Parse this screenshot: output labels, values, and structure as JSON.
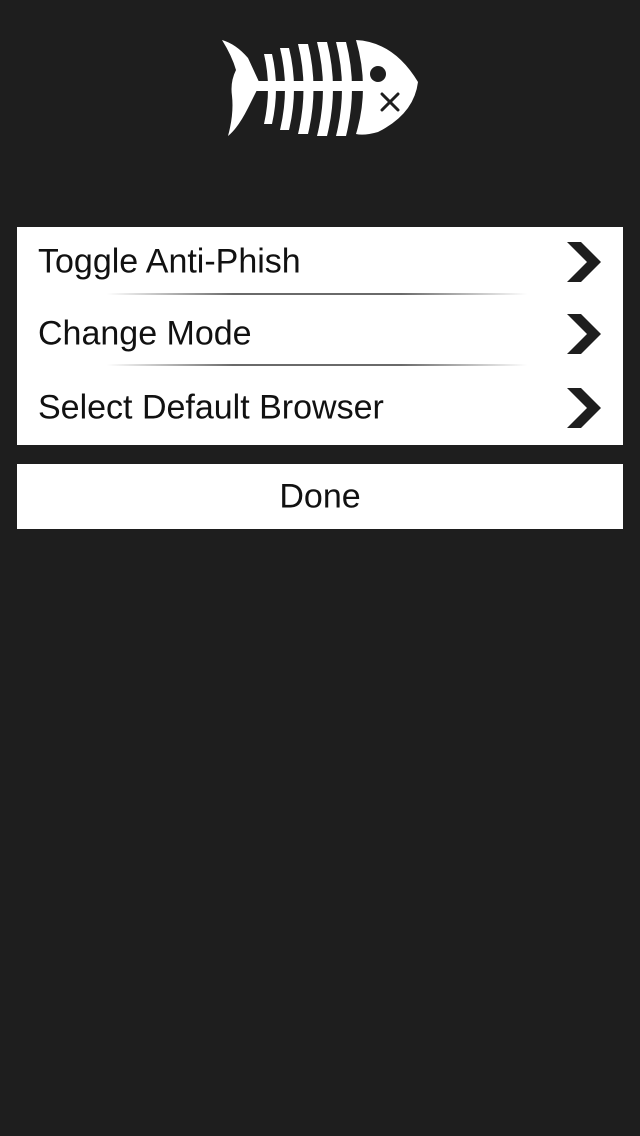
{
  "logo": {
    "icon": "fish-skeleton-icon",
    "color": "#ffffff"
  },
  "menu": {
    "items": [
      {
        "label": "Toggle Anti-Phish",
        "icon": "chevron-right-icon"
      },
      {
        "label": "Change Mode",
        "icon": "chevron-right-icon"
      },
      {
        "label": "Select Default Browser",
        "icon": "chevron-right-icon"
      }
    ]
  },
  "done_button": {
    "label": "Done"
  },
  "colors": {
    "background": "#1e1e1e",
    "panel": "#ffffff",
    "text": "#111111",
    "chevron": "#1e1e1e"
  }
}
